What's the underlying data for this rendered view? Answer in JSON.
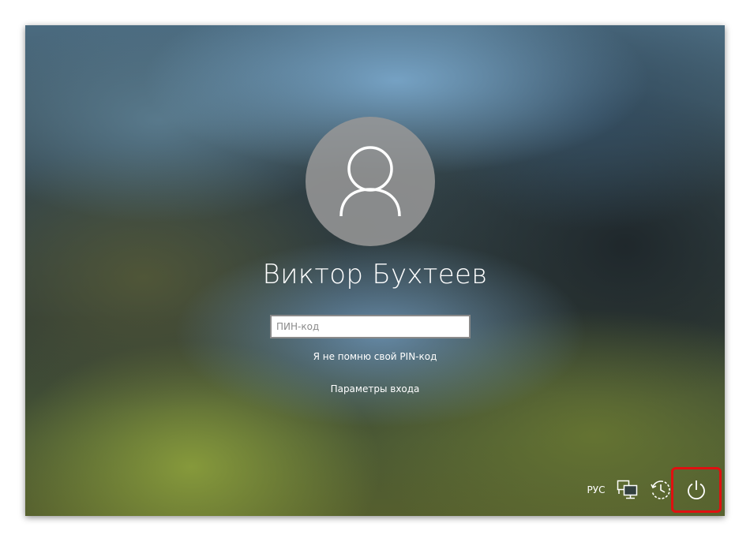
{
  "user": {
    "name": "Виктор Бухтеев"
  },
  "pin": {
    "placeholder": "ПИН-код",
    "value": ""
  },
  "links": {
    "forgot_pin": "Я не помню свой PIN-код",
    "sign_in_options": "Параметры входа"
  },
  "tray": {
    "language": "РУС",
    "network_icon": "network-icon",
    "ease_of_access_icon": "ease-of-access-icon",
    "power_icon": "power-icon"
  },
  "colors": {
    "highlight": "#e01010",
    "avatar_bg": "#969696",
    "text": "#ffffff"
  }
}
